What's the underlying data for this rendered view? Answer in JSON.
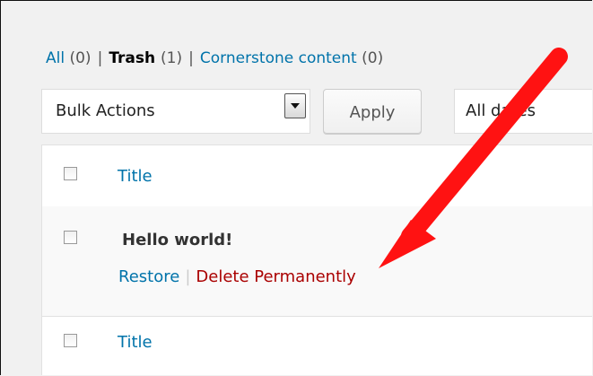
{
  "filters": {
    "all_label": "All",
    "all_count": "(0)",
    "trash_label": "Trash",
    "trash_count": "(1)",
    "cornerstone_label": "Cornerstone content",
    "cornerstone_count": "(0)",
    "separator": "|"
  },
  "toolbar": {
    "bulk_actions": "Bulk Actions",
    "apply_label": "Apply",
    "dates_label": "All dates"
  },
  "table": {
    "header_title": "Title",
    "footer_title": "Title",
    "rows": [
      {
        "title": "Hello world!",
        "actions": {
          "restore": "Restore",
          "divider": "|",
          "delete": "Delete Permanently"
        }
      }
    ]
  },
  "annotation": {
    "color": "#ff1212",
    "icon": "red-arrow"
  }
}
